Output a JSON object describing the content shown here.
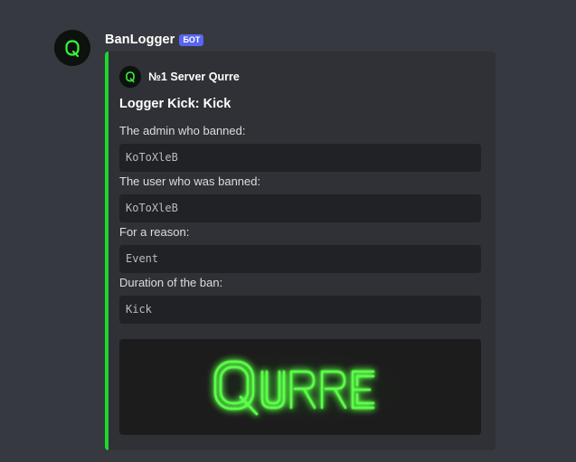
{
  "message": {
    "username": "BanLogger",
    "bot_tag": "БОТ",
    "avatar_icon": "qurre-q-logo-icon"
  },
  "embed": {
    "accent_color": "#1ed82c",
    "author": {
      "icon": "qurre-q-logo-icon",
      "name": "№1 Server Qurre"
    },
    "title": "Logger Kick: Kick",
    "fields": [
      {
        "name": "The admin who banned:",
        "value": "KoToXleB"
      },
      {
        "name": "The user who was banned:",
        "value": "KoToXleB"
      },
      {
        "name": "For a reason:",
        "value": "Event"
      },
      {
        "name": "Duration of the ban:",
        "value": "Kick"
      }
    ],
    "image": {
      "text": "QURRE",
      "glow_color": "#3cff3c"
    }
  }
}
